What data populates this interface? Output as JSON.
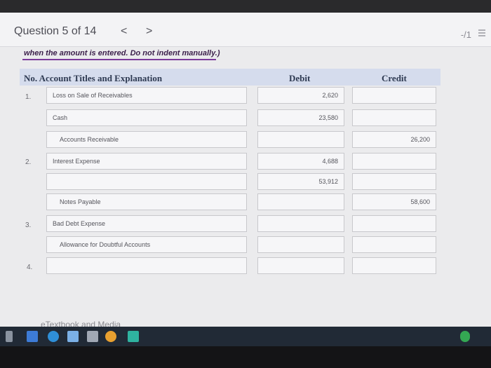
{
  "header": {
    "question_label": "Question 5 of 14",
    "prev_icon": "<",
    "next_icon": ">",
    "score": "-/1"
  },
  "instruction": "when the amount is entered. Do not indent manually.)",
  "table": {
    "col_no_title": "No. Account Titles and Explanation",
    "col_debit": "Debit",
    "col_credit": "Credit"
  },
  "rows": [
    {
      "no": "1.",
      "account": "Loss on Sale of Receivables",
      "debit": "2,620",
      "credit": ""
    },
    {
      "no": "",
      "account": "Cash",
      "debit": "23,580",
      "credit": ""
    },
    {
      "no": "",
      "account": "Accounts Receivable",
      "debit": "",
      "credit": "26,200"
    },
    {
      "no": "2.",
      "account": "Interest Expense",
      "debit": "4,688",
      "credit": ""
    },
    {
      "no": "",
      "account": "",
      "debit": "53,912",
      "credit": ""
    },
    {
      "no": "",
      "account": "Notes Payable",
      "debit": "",
      "credit": "58,600"
    },
    {
      "no": "3.",
      "account": "Bad Debt Expense",
      "debit": "",
      "credit": ""
    },
    {
      "no": "",
      "account": "Allowance for Doubtful Accounts",
      "debit": "",
      "credit": ""
    },
    {
      "no": "4.",
      "account": "",
      "debit": "",
      "credit": ""
    }
  ],
  "footer": {
    "etextbook_label": "eTextbook and Media"
  },
  "taskbar": {
    "icons": [
      "dropbox-icon",
      "edge-icon",
      "mail-icon",
      "chrome-icon",
      "store-icon"
    ]
  },
  "colors": {
    "header_band": "#d5dced",
    "instruction_accent": "#7a3a9a",
    "taskbar": "#212a36"
  }
}
